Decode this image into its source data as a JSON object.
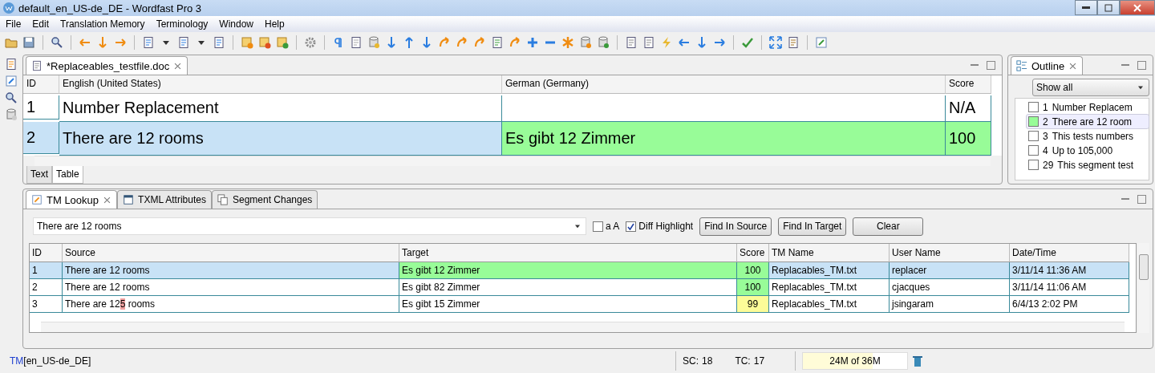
{
  "window": {
    "title": "default_en_US-de_DE - Wordfast Pro 3"
  },
  "menu": [
    "File",
    "Edit",
    "Translation Memory",
    "Terminology",
    "Window",
    "Help"
  ],
  "editor": {
    "tab": "*Replaceables_testfile.doc",
    "columns": [
      "ID",
      "English (United States)",
      "German (Germany)",
      "Score"
    ],
    "rows": [
      {
        "id": "1",
        "source": "Number Replacement",
        "target": "",
        "score": "N/A",
        "selected": false
      },
      {
        "id": "2",
        "source": "There are 12 rooms",
        "target": "Es gibt 12 Zimmer",
        "score": "100",
        "color": "#98fc98",
        "selected": true
      }
    ],
    "view_tabs": [
      {
        "label": "Text",
        "selected": false
      },
      {
        "label": "Table",
        "selected": true
      }
    ]
  },
  "outline": {
    "tab": "Outline",
    "filter": "Show all",
    "items": [
      {
        "number": "1",
        "text": "Number Replacem",
        "selected": false
      },
      {
        "number": "2",
        "text": "There are 12 room",
        "selected": true
      },
      {
        "number": "3",
        "text": "This tests numbers",
        "selected": false
      },
      {
        "number": "4",
        "text": "Up to 105,000",
        "selected": false
      },
      {
        "number": "29",
        "text": "This segment test",
        "selected": false
      }
    ]
  },
  "lookup": {
    "tabs": [
      {
        "label": "TM Lookup",
        "kind": "lookup",
        "selected": true
      },
      {
        "label": "TXML Attributes",
        "kind": "attributes",
        "selected": false
      },
      {
        "label": "Segment Changes",
        "kind": "changes",
        "selected": false
      }
    ],
    "query": "There are 12 rooms",
    "options": [
      {
        "label": "a A",
        "checked": false
      },
      {
        "label": "Diff Highlight",
        "checked": true
      }
    ],
    "buttons": [
      "Find In Source",
      "Find In Target",
      "Clear"
    ],
    "columns": [
      "ID",
      "Source",
      "Target",
      "Score",
      "TM Name",
      "User Name",
      "Date/Time"
    ],
    "rows": [
      {
        "id": "1",
        "source": [
          {
            "text": "There are 12 rooms",
            "diff": false
          }
        ],
        "target": "Es gibt 12 Zimmer",
        "score": "100",
        "color": "#98fc98",
        "tm": "Replacables_TM.txt",
        "user": "replacer",
        "date": "3/11/14 11:36 AM",
        "selected": true
      },
      {
        "id": "2",
        "source": [
          {
            "text": "There are 12 rooms",
            "diff": false
          }
        ],
        "target": "Es gibt 82 Zimmer",
        "score": "100",
        "color": "#98fc98",
        "tm": "Replacables_TM.txt",
        "user": "cjacques",
        "date": "3/11/14 11:06 AM",
        "selected": false
      },
      {
        "id": "3",
        "source": [
          {
            "text": "There are 12",
            "diff": false
          },
          {
            "text": "5",
            "diff": true
          },
          {
            "text": " rooms",
            "diff": false
          }
        ],
        "target": "Es gibt 15 Zimmer",
        "score": "99",
        "color": "#fcfc98",
        "tm": "Replacables_TM.txt",
        "user": "jsingaram",
        "date": "6/4/13 2:02 PM",
        "selected": false
      }
    ]
  },
  "status": {
    "tm_prefix": "TM",
    "locale": "[en_US-de_DE]",
    "sc_label": "SC:",
    "sc": "18",
    "tc_label": "TC:",
    "tc": "17",
    "memory": "24M of 36M",
    "level": 0.67
  }
}
